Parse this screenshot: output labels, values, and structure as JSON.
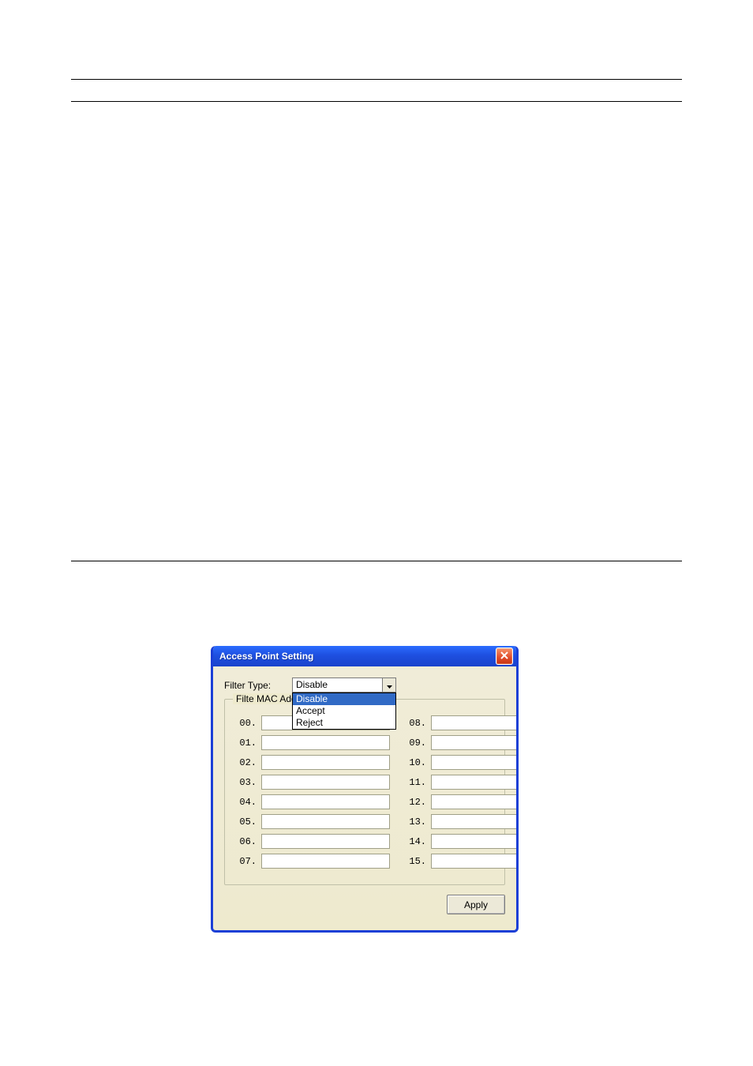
{
  "dialog": {
    "title": "Access Point Setting",
    "filter_type_label": "Filter Type:",
    "combo": {
      "selected": "Disable",
      "options": [
        "Disable",
        "Accept",
        "Reject"
      ]
    },
    "group_label": "Filte MAC Address",
    "fields": {
      "left": [
        "00.",
        "01.",
        "02.",
        "03.",
        "04.",
        "05.",
        "06.",
        "07."
      ],
      "right": [
        "08.",
        "09.",
        "10.",
        "11.",
        "12.",
        "13.",
        "14.",
        "15."
      ]
    },
    "apply_label": "Apply"
  }
}
